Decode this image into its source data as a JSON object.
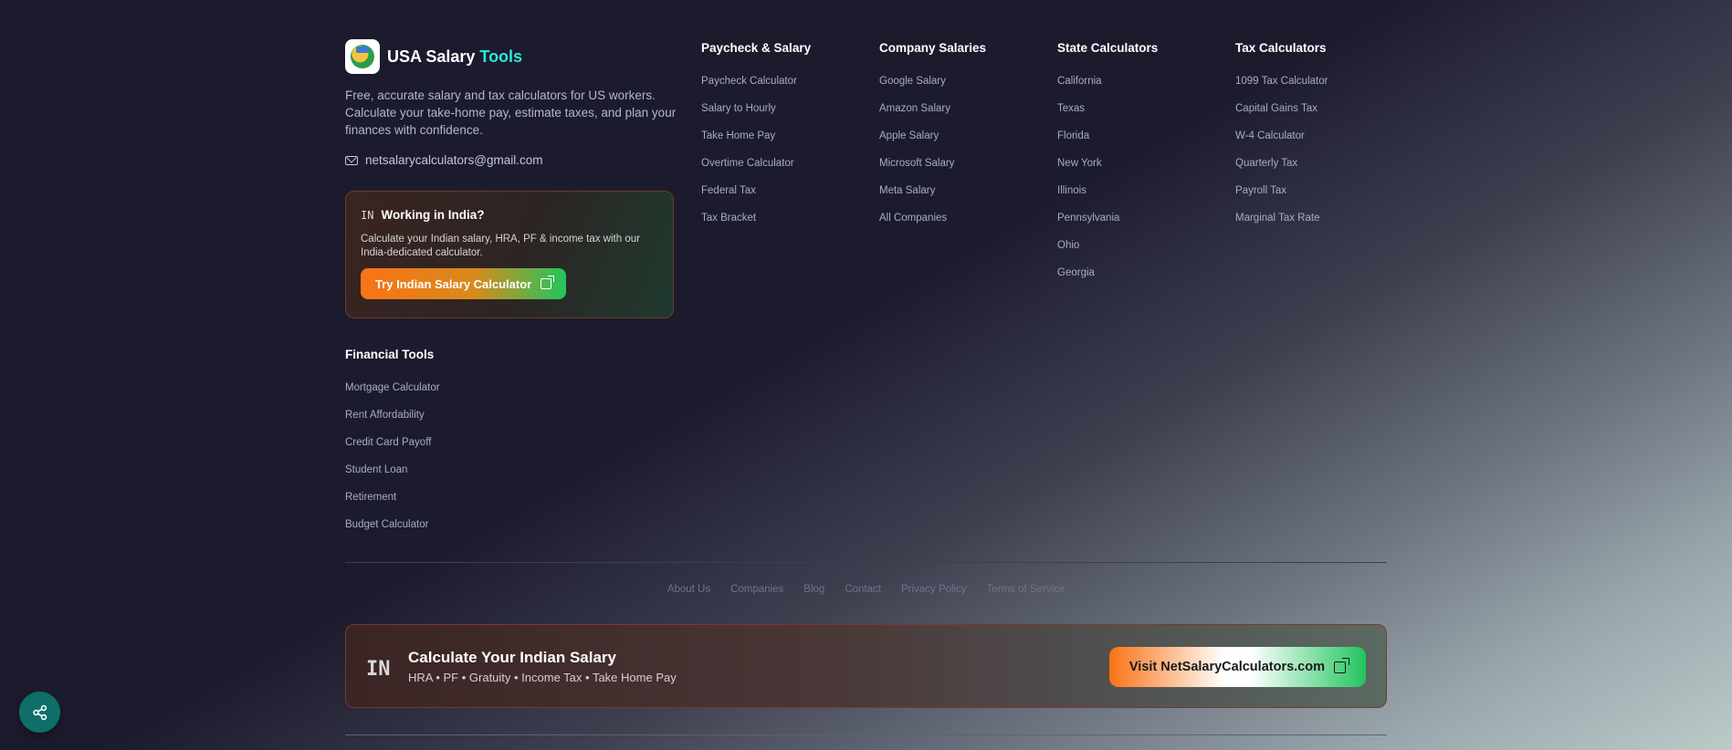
{
  "brand": {
    "name": "USA Salary",
    "accent": "Tools"
  },
  "description": "Free, accurate salary and tax calculators for US workers. Calculate your take-home pay, estimate taxes, and plan your finances with confidence.",
  "email": "netsalarycalculators@gmail.com",
  "india_card": {
    "code": "IN",
    "title": "Working in India?",
    "text": "Calculate your Indian salary, HRA, PF & income tax with our India-dedicated calculator.",
    "button": "Try Indian Salary Calculator"
  },
  "columns": [
    {
      "title": "Paycheck & Salary",
      "items": [
        "Paycheck Calculator",
        "Salary to Hourly",
        "Take Home Pay",
        "Overtime Calculator",
        "Federal Tax",
        "Tax Bracket"
      ]
    },
    {
      "title": "Company Salaries",
      "items": [
        "Google Salary",
        "Amazon Salary",
        "Apple Salary",
        "Microsoft Salary",
        "Meta Salary",
        "All Companies"
      ]
    },
    {
      "title": "State Calculators",
      "items": [
        "California",
        "Texas",
        "Florida",
        "New York",
        "Illinois",
        "Pennsylvania",
        "Ohio",
        "Georgia"
      ]
    },
    {
      "title": "Tax Calculators",
      "items": [
        "1099 Tax Calculator",
        "Capital Gains Tax",
        "W-4 Calculator",
        "Quarterly Tax",
        "Payroll Tax",
        "Marginal Tax Rate"
      ]
    }
  ],
  "financial_tools": {
    "title": "Financial Tools",
    "items": [
      "Mortgage Calculator",
      "Rent Affordability",
      "Credit Card Payoff",
      "Student Loan",
      "Retirement",
      "Budget Calculator"
    ]
  },
  "bottom_links": [
    "About Us",
    "Companies",
    "Blog",
    "Contact",
    "Privacy Policy",
    "Terms of Service"
  ],
  "promo": {
    "code": "IN",
    "title": "Calculate Your Indian Salary",
    "subtitle": "HRA • PF • Gratuity • Income Tax • Take Home Pay",
    "button": "Visit NetSalaryCalculators.com"
  },
  "colors": {
    "background": "#1c1b2e",
    "accent": "#2ee6d6",
    "orange": "#f97316",
    "green": "#22c55e",
    "share": "#0f6e69"
  },
  "icons": {
    "logo": "salary-logo-icon",
    "email": "mail-icon",
    "external": "external-link-icon",
    "share": "share-icon"
  }
}
